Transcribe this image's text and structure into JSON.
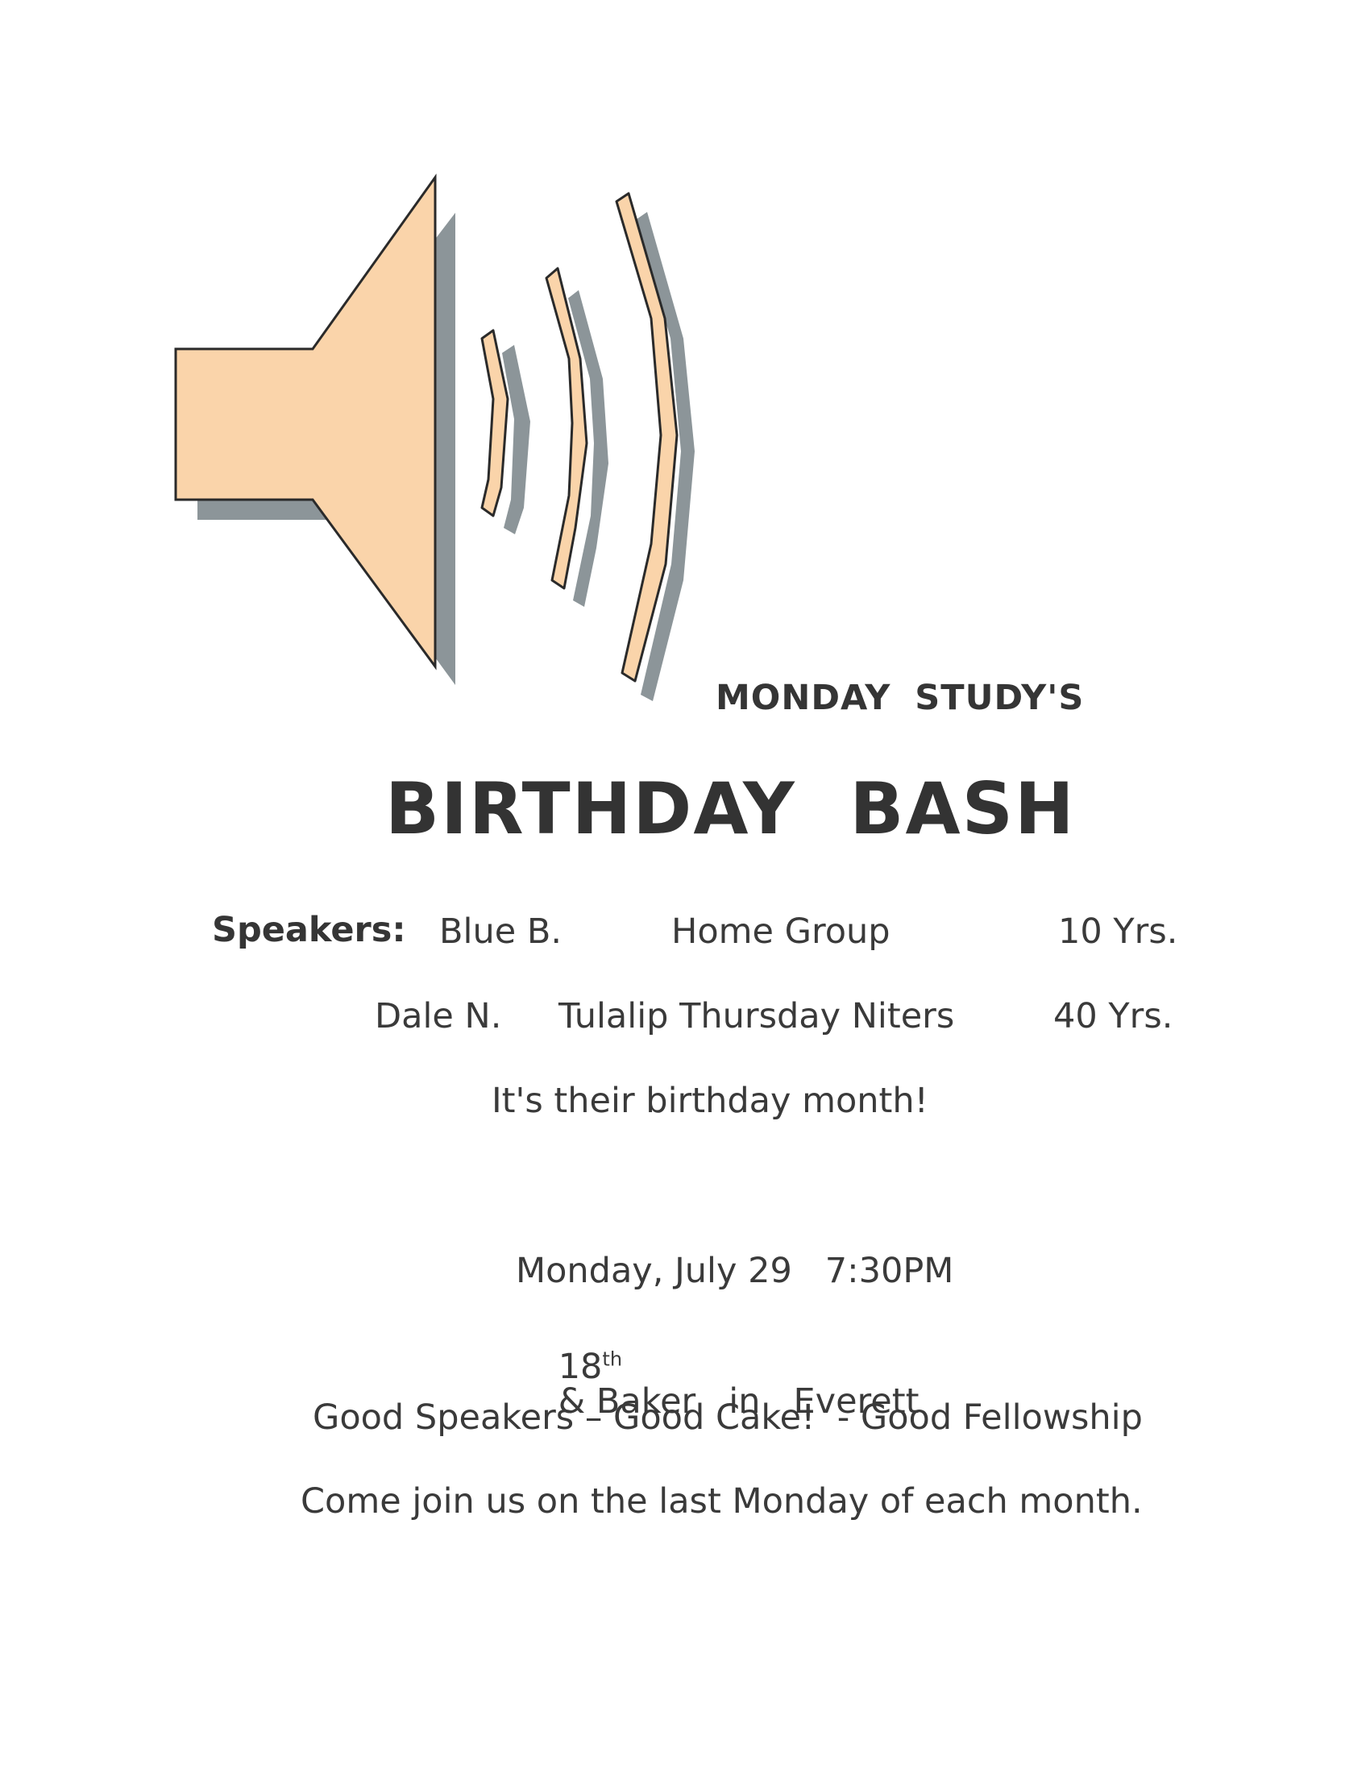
{
  "header": {
    "subtitle": "MONDAY STUDY'S",
    "title": "BIRTHDAY BASH"
  },
  "graphic": {
    "icon": "loudspeaker-icon",
    "fill_color": "#fad4aa",
    "shadow_color": "#8c9599",
    "outline_color": "#2a2a2a"
  },
  "speakers": {
    "label": "Speakers:",
    "list": [
      {
        "name": "Blue B.",
        "group": "Home Group",
        "years": "10 Yrs."
      },
      {
        "name": "Dale N.",
        "group": "Tulalip Thursday Niters",
        "years": "40 Yrs."
      }
    ],
    "note": "It's their birthday month!"
  },
  "event": {
    "date_time": "Monday, July 29   7:30PM",
    "address_number": "18",
    "address_ordinal": "th",
    "address_rest": "& Baker   in   Everett",
    "tagline": "Good Speakers – Good Cake!  - Good Fellowship",
    "invite": "Come join us on the last Monday of each month."
  }
}
